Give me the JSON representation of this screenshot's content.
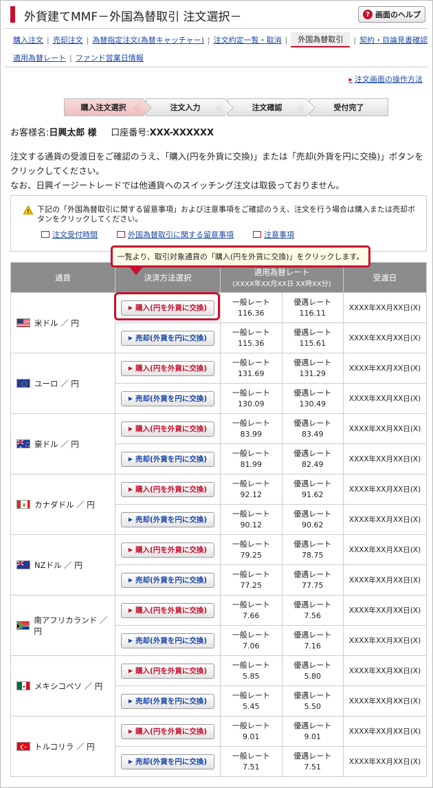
{
  "header": {
    "title": "外貨建てMMF－外国為替取引 注文選択－",
    "help_label": "画面のヘルプ"
  },
  "nav": {
    "row1": [
      "購入注文",
      "売却注文",
      "為替指定注文(為替キャッチャー)",
      "注文約定一覧・取消",
      "外国為替取引",
      "契約・目論見書確認"
    ],
    "active": "外国為替取引",
    "row2": [
      "適用為替レート",
      "ファンド営業日情報"
    ]
  },
  "howto_link": "注文画面の操作方法",
  "steps": [
    "購入注文選択",
    "注文入力",
    "注文確認",
    "受付完了"
  ],
  "customer": {
    "name_label": "お客様名:",
    "name": "日興太郎",
    "suffix": "様",
    "account_label": "口座番号:",
    "account": "XXX-XXXXXX"
  },
  "intro": [
    "注文する通貨の受渡日をご確認のうえ、「購入(円を外貨に交換)」または「売却(外貨を円に交換)」ボタンをクリックしてください。",
    "なお、日興イージートレードでは他通貨へのスイッチング注文は取扱っておりません。"
  ],
  "notice": {
    "text": "下記の「外国為替取引に関する留意事項」および注意事項をご確認のうえ、注文を行う場合は購入または売却ボタンをクリックしてください。",
    "links": [
      "注文受付時間",
      "外国為替取引に関する留意事項",
      "注意事項"
    ]
  },
  "callout": "一覧より、取引対象通貨の「購入(円を外貨に交換)」をクリックします。",
  "table": {
    "headers": {
      "currency": "通貨",
      "method": "決済方法選択",
      "rate": "適用為替レート",
      "rate_sub": "(XXXX年XX月XX日 XX時XX分)",
      "delivery": "受渡日"
    },
    "general_label": "一般レート",
    "preferred_label": "優遇レート",
    "buy_label": "購入(円を外貨に交換)",
    "sell_label": "売却(外貨を円に交換)",
    "date": "XXXX年XX月XX日(X)",
    "rows": [
      {
        "name": "米ドル ／ 円",
        "flag": "us",
        "buy": [
          "116.36",
          "116.11"
        ],
        "sell": [
          "115.36",
          "115.61"
        ]
      },
      {
        "name": "ユーロ ／ 円",
        "flag": "eu",
        "buy": [
          "131.69",
          "131.29"
        ],
        "sell": [
          "130.09",
          "130.49"
        ]
      },
      {
        "name": "豪ドル ／ 円",
        "flag": "au",
        "buy": [
          "83.99",
          "83.49"
        ],
        "sell": [
          "81.99",
          "82.49"
        ]
      },
      {
        "name": "カナダドル ／ 円",
        "flag": "ca",
        "buy": [
          "92.12",
          "91.62"
        ],
        "sell": [
          "90.12",
          "90.62"
        ]
      },
      {
        "name": "NZドル ／ 円",
        "flag": "nz",
        "buy": [
          "79.25",
          "78.75"
        ],
        "sell": [
          "77.25",
          "77.75"
        ]
      },
      {
        "name": "南アフリカランド ／ 円",
        "flag": "za",
        "buy": [
          "7.66",
          "7.56"
        ],
        "sell": [
          "7.06",
          "7.16"
        ]
      },
      {
        "name": "メキシコペソ ／ 円",
        "flag": "mx",
        "buy": [
          "5.85",
          "5.80"
        ],
        "sell": [
          "5.45",
          "5.50"
        ]
      },
      {
        "name": "トルコリラ ／ 円",
        "flag": "tr",
        "buy": [
          "9.01",
          "9.01"
        ],
        "sell": [
          "7.51",
          "7.51"
        ]
      }
    ]
  }
}
